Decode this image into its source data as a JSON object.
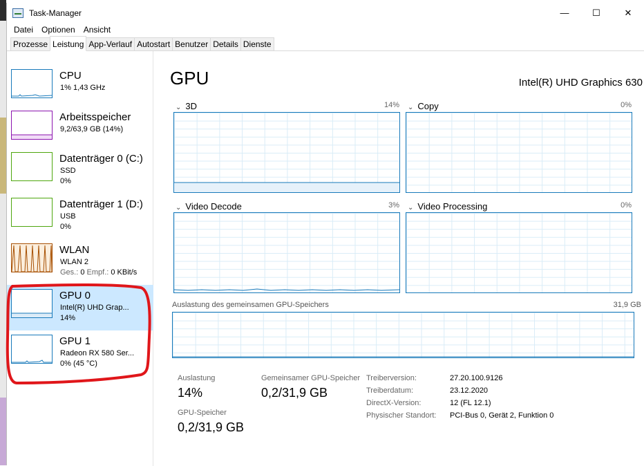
{
  "window": {
    "title": "Task-Manager",
    "minimize": "—",
    "maximize": "☐",
    "close": "✕"
  },
  "menu": [
    "Datei",
    "Optionen",
    "Ansicht"
  ],
  "tabs": [
    "Prozesse",
    "Leistung",
    "App-Verlauf",
    "Autostart",
    "Benutzer",
    "Details",
    "Dienste"
  ],
  "active_tab": "Leistung",
  "resources": [
    {
      "title": "CPU",
      "line1": "1% 1,43 GHz",
      "line2": "",
      "color": "#1779ba"
    },
    {
      "title": "Arbeitsspeicher",
      "line1": "9,2/63,9 GB (14%)",
      "line2": "",
      "color": "#8b12ae"
    },
    {
      "title": "Datenträger 0 (C:)",
      "line1": "SSD",
      "line2": "0%",
      "color": "#4da60c"
    },
    {
      "title": "Datenträger 1 (D:)",
      "line1": "USB",
      "line2": "0%",
      "color": "#4da60c"
    },
    {
      "title": "WLAN",
      "line1": "WLAN 2",
      "line2_gray1": "Ges.: ",
      "line2_val1": "0",
      "line2_gray2": " Empf.: ",
      "line2_val2": "0 KBit/s",
      "color": "#a74f01"
    },
    {
      "title": "GPU 0",
      "line1": "Intel(R) UHD Grap...",
      "line2": "14%",
      "color": "#1779ba"
    },
    {
      "title": "GPU 1",
      "line1": "Radeon RX 580 Ser...",
      "line2": "0%  (45 °C)",
      "color": "#1779ba"
    }
  ],
  "main": {
    "title": "GPU",
    "gpu_name": "Intel(R) UHD Graphics 630",
    "engines": [
      {
        "name": "3D",
        "percent": "14%",
        "value": 14
      },
      {
        "name": "Copy",
        "percent": "0%",
        "value": 0
      },
      {
        "name": "Video Decode",
        "percent": "3%",
        "value": 3
      },
      {
        "name": "Video Processing",
        "percent": "0%",
        "value": 0
      }
    ],
    "shared_memory_label": "Auslastung des gemeinsamen GPU-Speichers",
    "shared_memory_max": "31,9 GB",
    "stats": {
      "utilization_label": "Auslastung",
      "utilization_value": "14%",
      "shared_label": "Gemeinsamer GPU-Speicher",
      "shared_value": "0,2/31,9 GB",
      "gpu_memory_label": "GPU-Speicher",
      "gpu_memory_value": "0,2/31,9 GB"
    },
    "info": [
      {
        "key": "Treiberversion:",
        "value": "27.20.100.9126"
      },
      {
        "key": "Treiberdatum:",
        "value": "23.12.2020"
      },
      {
        "key": "DirectX-Version:",
        "value": "12 (FL 12.1)"
      },
      {
        "key": "Physischer Standort:",
        "value": "PCI-Bus 0, Gerät 2, Funktion 0"
      }
    ]
  },
  "colors": {
    "accent": "#1779ba",
    "selected_bg": "#cce8ff",
    "annotation": "#e0161a"
  }
}
